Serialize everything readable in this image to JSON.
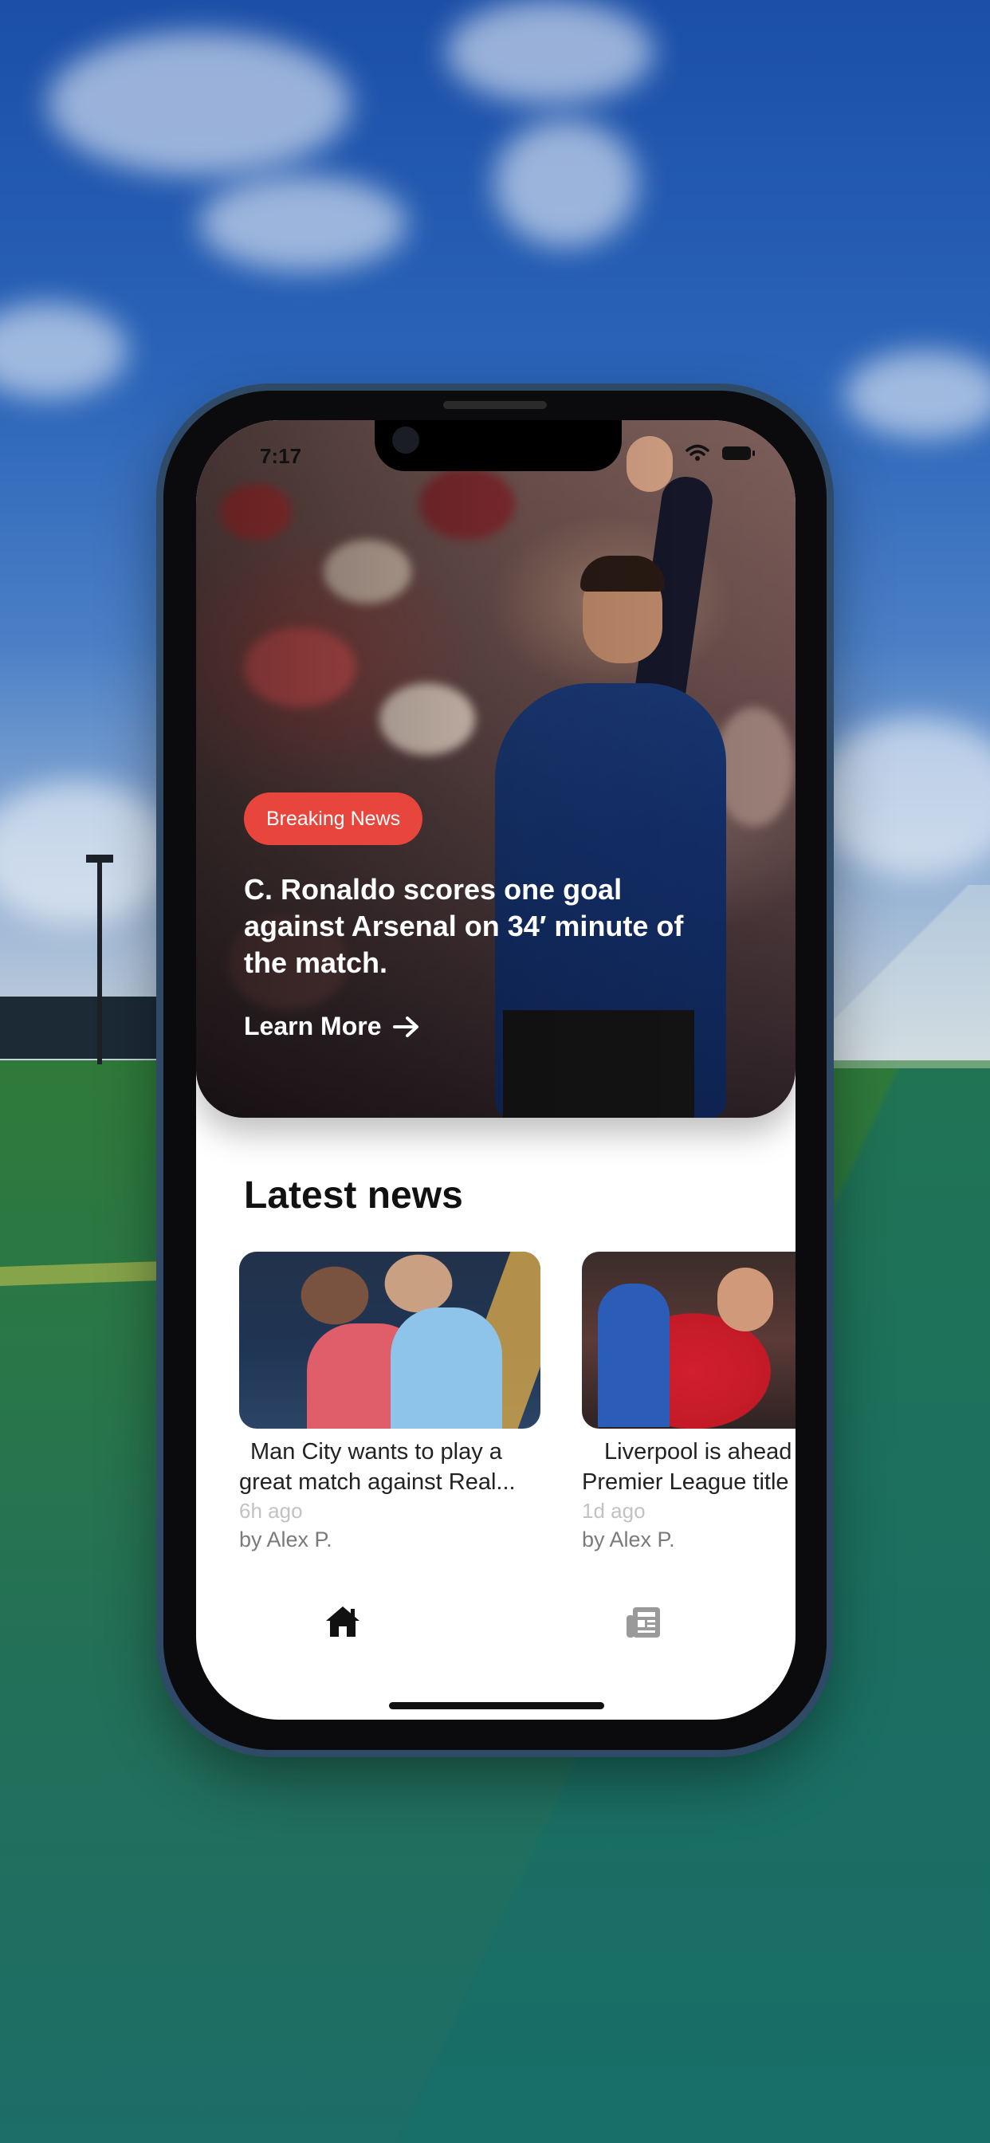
{
  "status_bar": {
    "time": "7:17"
  },
  "hero": {
    "badge": "Breaking News",
    "headline": "C. Ronaldo scores one goal against Arsenal on 34′ minute of the match.",
    "cta": "Learn More"
  },
  "latest_news": {
    "title": "Latest news",
    "cards": [
      {
        "title_line1": "Man City wants to play a",
        "title_line2": "great match against Real...",
        "time": "6h ago",
        "author": "by Alex P."
      },
      {
        "title_line1": "Liverpool is ahead",
        "title_line2": "Premier League title",
        "time": "1d ago",
        "author": "by Alex P."
      }
    ]
  },
  "tab_bar": {
    "items": [
      {
        "icon": "home-icon",
        "active": true
      },
      {
        "icon": "newspaper-icon",
        "active": false
      }
    ]
  },
  "colors": {
    "accent": "#e8453c",
    "tab_active": "#111111",
    "tab_inactive": "#9a9a9a",
    "muted_text": "#c2c2c2"
  }
}
